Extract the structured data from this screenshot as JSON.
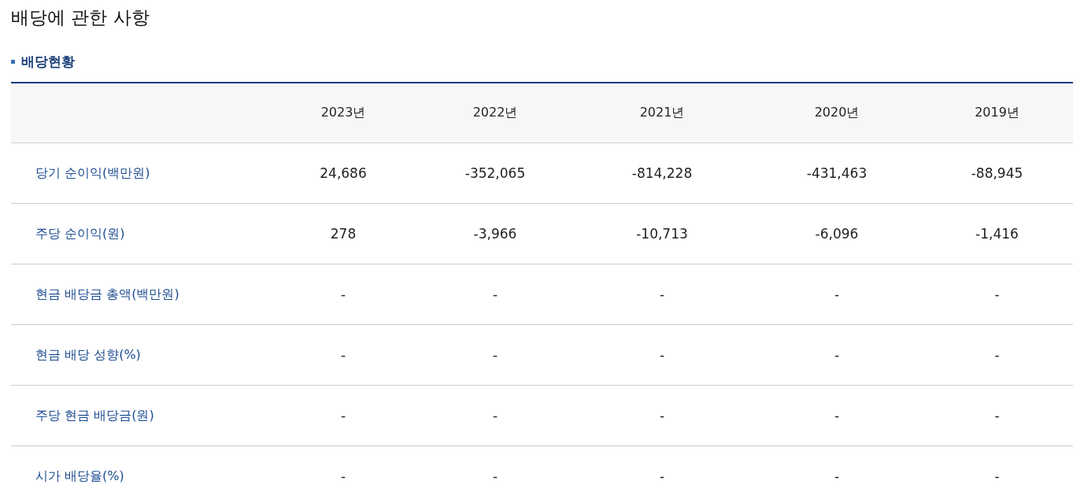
{
  "title": "배당에 관한 사항",
  "section_title": "배당현황",
  "table": {
    "columns": [
      "2023년",
      "2022년",
      "2021년",
      "2020년",
      "2019년"
    ],
    "rows": [
      {
        "label": "당기 순이익(백만원)",
        "values": [
          "24,686",
          "-352,065",
          "-814,228",
          "-431,463",
          "-88,945"
        ]
      },
      {
        "label": "주당 순이익(원)",
        "values": [
          "278",
          "-3,966",
          "-10,713",
          "-6,096",
          "-1,416"
        ]
      },
      {
        "label": "현금 배당금 총액(백만원)",
        "values": [
          "-",
          "-",
          "-",
          "-",
          "-"
        ]
      },
      {
        "label": "현금 배당 성향(%)",
        "values": [
          "-",
          "-",
          "-",
          "-",
          "-"
        ]
      },
      {
        "label": "주당 현금 배당금(원)",
        "values": [
          "-",
          "-",
          "-",
          "-",
          "-"
        ]
      },
      {
        "label": "시가 배당율(%)",
        "values": [
          "-",
          "-",
          "-",
          "-",
          "-"
        ]
      }
    ]
  }
}
